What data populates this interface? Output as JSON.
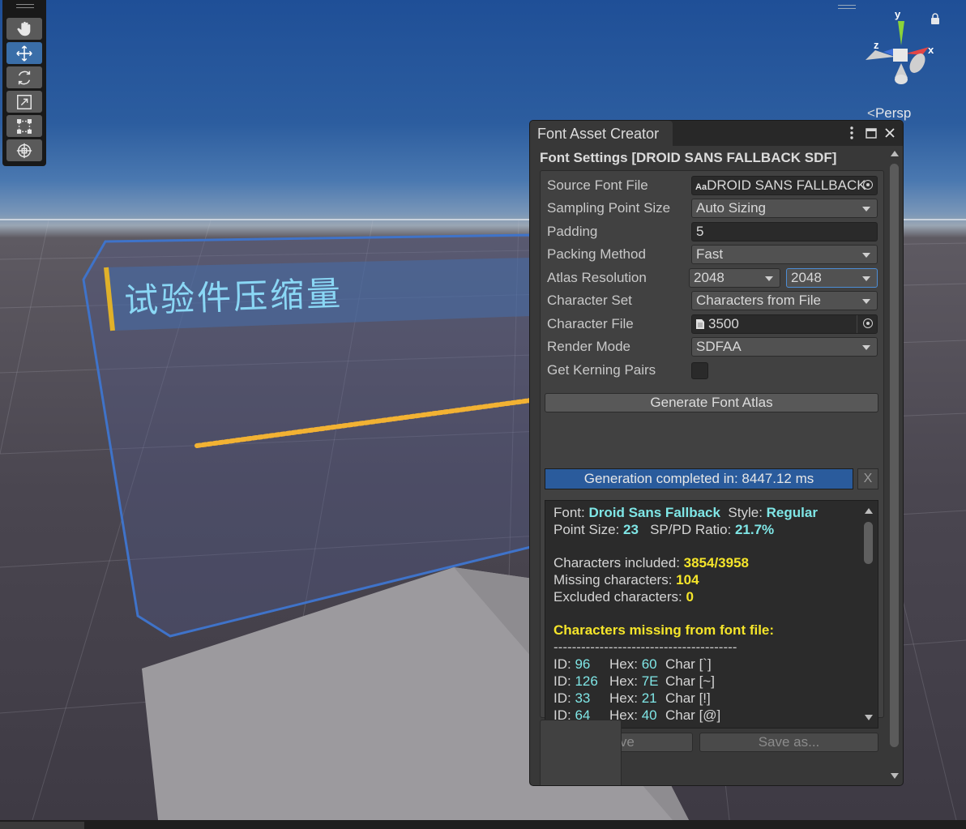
{
  "scene": {
    "sign_text": "试验件压缩量",
    "view_label": "Persp",
    "axes": {
      "x": "x",
      "y": "y",
      "z": "z"
    },
    "colors": {
      "sky_top": "#1f4f97",
      "sign_text": "#8ad7f5",
      "sign_accent": "#e0b12a",
      "panel_edge": "#3f73c9",
      "dots": "#f2b233"
    }
  },
  "tools": [
    {
      "name": "hand-tool",
      "icon": "hand-icon"
    },
    {
      "name": "move-tool",
      "icon": "move-icon",
      "active": true
    },
    {
      "name": "rotate-tool",
      "icon": "rotate-icon"
    },
    {
      "name": "scale-tool",
      "icon": "scale-icon"
    },
    {
      "name": "rect-tool",
      "icon": "rect-transform-icon"
    },
    {
      "name": "transform-tool",
      "icon": "transform-icon"
    }
  ],
  "window": {
    "title": "Font Asset Creator",
    "section_title": "Font Settings [DROID SANS FALLBACK SDF]",
    "props": {
      "source_font_label": "Source Font File",
      "source_font_value": "DROID SANS FALLBACK",
      "source_font_icon_text": "Aa",
      "sampling_label": "Sampling Point Size",
      "sampling_value": "Auto Sizing",
      "padding_label": "Padding",
      "padding_value": "5",
      "packing_label": "Packing Method",
      "packing_value": "Fast",
      "atlas_label": "Atlas Resolution",
      "atlas_width": "2048",
      "atlas_height": "2048",
      "charset_label": "Character Set",
      "charset_value": "Characters from File",
      "charfile_label": "Character File",
      "charfile_value": "3500",
      "render_label": "Render Mode",
      "render_value": "SDFAA",
      "kerning_label": "Get Kerning Pairs",
      "kerning_checked": false
    },
    "generate_label": "Generate Font Atlas",
    "progress_text": "Generation completed in: 8447.12 ms",
    "progress": 1.0,
    "progress_close": "X",
    "info": {
      "font_label": "Font: ",
      "font_value": "Droid Sans Fallback",
      "style_label": "  Style: ",
      "style_value": "Regular",
      "point_label": "Point Size: ",
      "point_value": "23",
      "ratio_label": "   SP/PD Ratio: ",
      "ratio_value": "21.7%",
      "included_label": "Characters included: ",
      "included_value": "3854/3958",
      "missing_label": "Missing characters: ",
      "missing_value": "104",
      "excluded_label": "Excluded characters: ",
      "excluded_value": "0",
      "missing_header": "Characters missing from font file:",
      "separator": "----------------------------------------",
      "missing_rows": [
        {
          "id": "96",
          "hex": "60",
          "char": "[`]"
        },
        {
          "id": "126",
          "hex": "7E",
          "char": "[~]"
        },
        {
          "id": "33",
          "hex": "21",
          "char": "[!]"
        },
        {
          "id": "64",
          "hex": "40",
          "char": "[@]"
        }
      ],
      "id_label": "ID: ",
      "hex_label": "Hex: ",
      "char_label": "Char "
    },
    "save_label": "Save",
    "save_as_label": "Save as..."
  }
}
